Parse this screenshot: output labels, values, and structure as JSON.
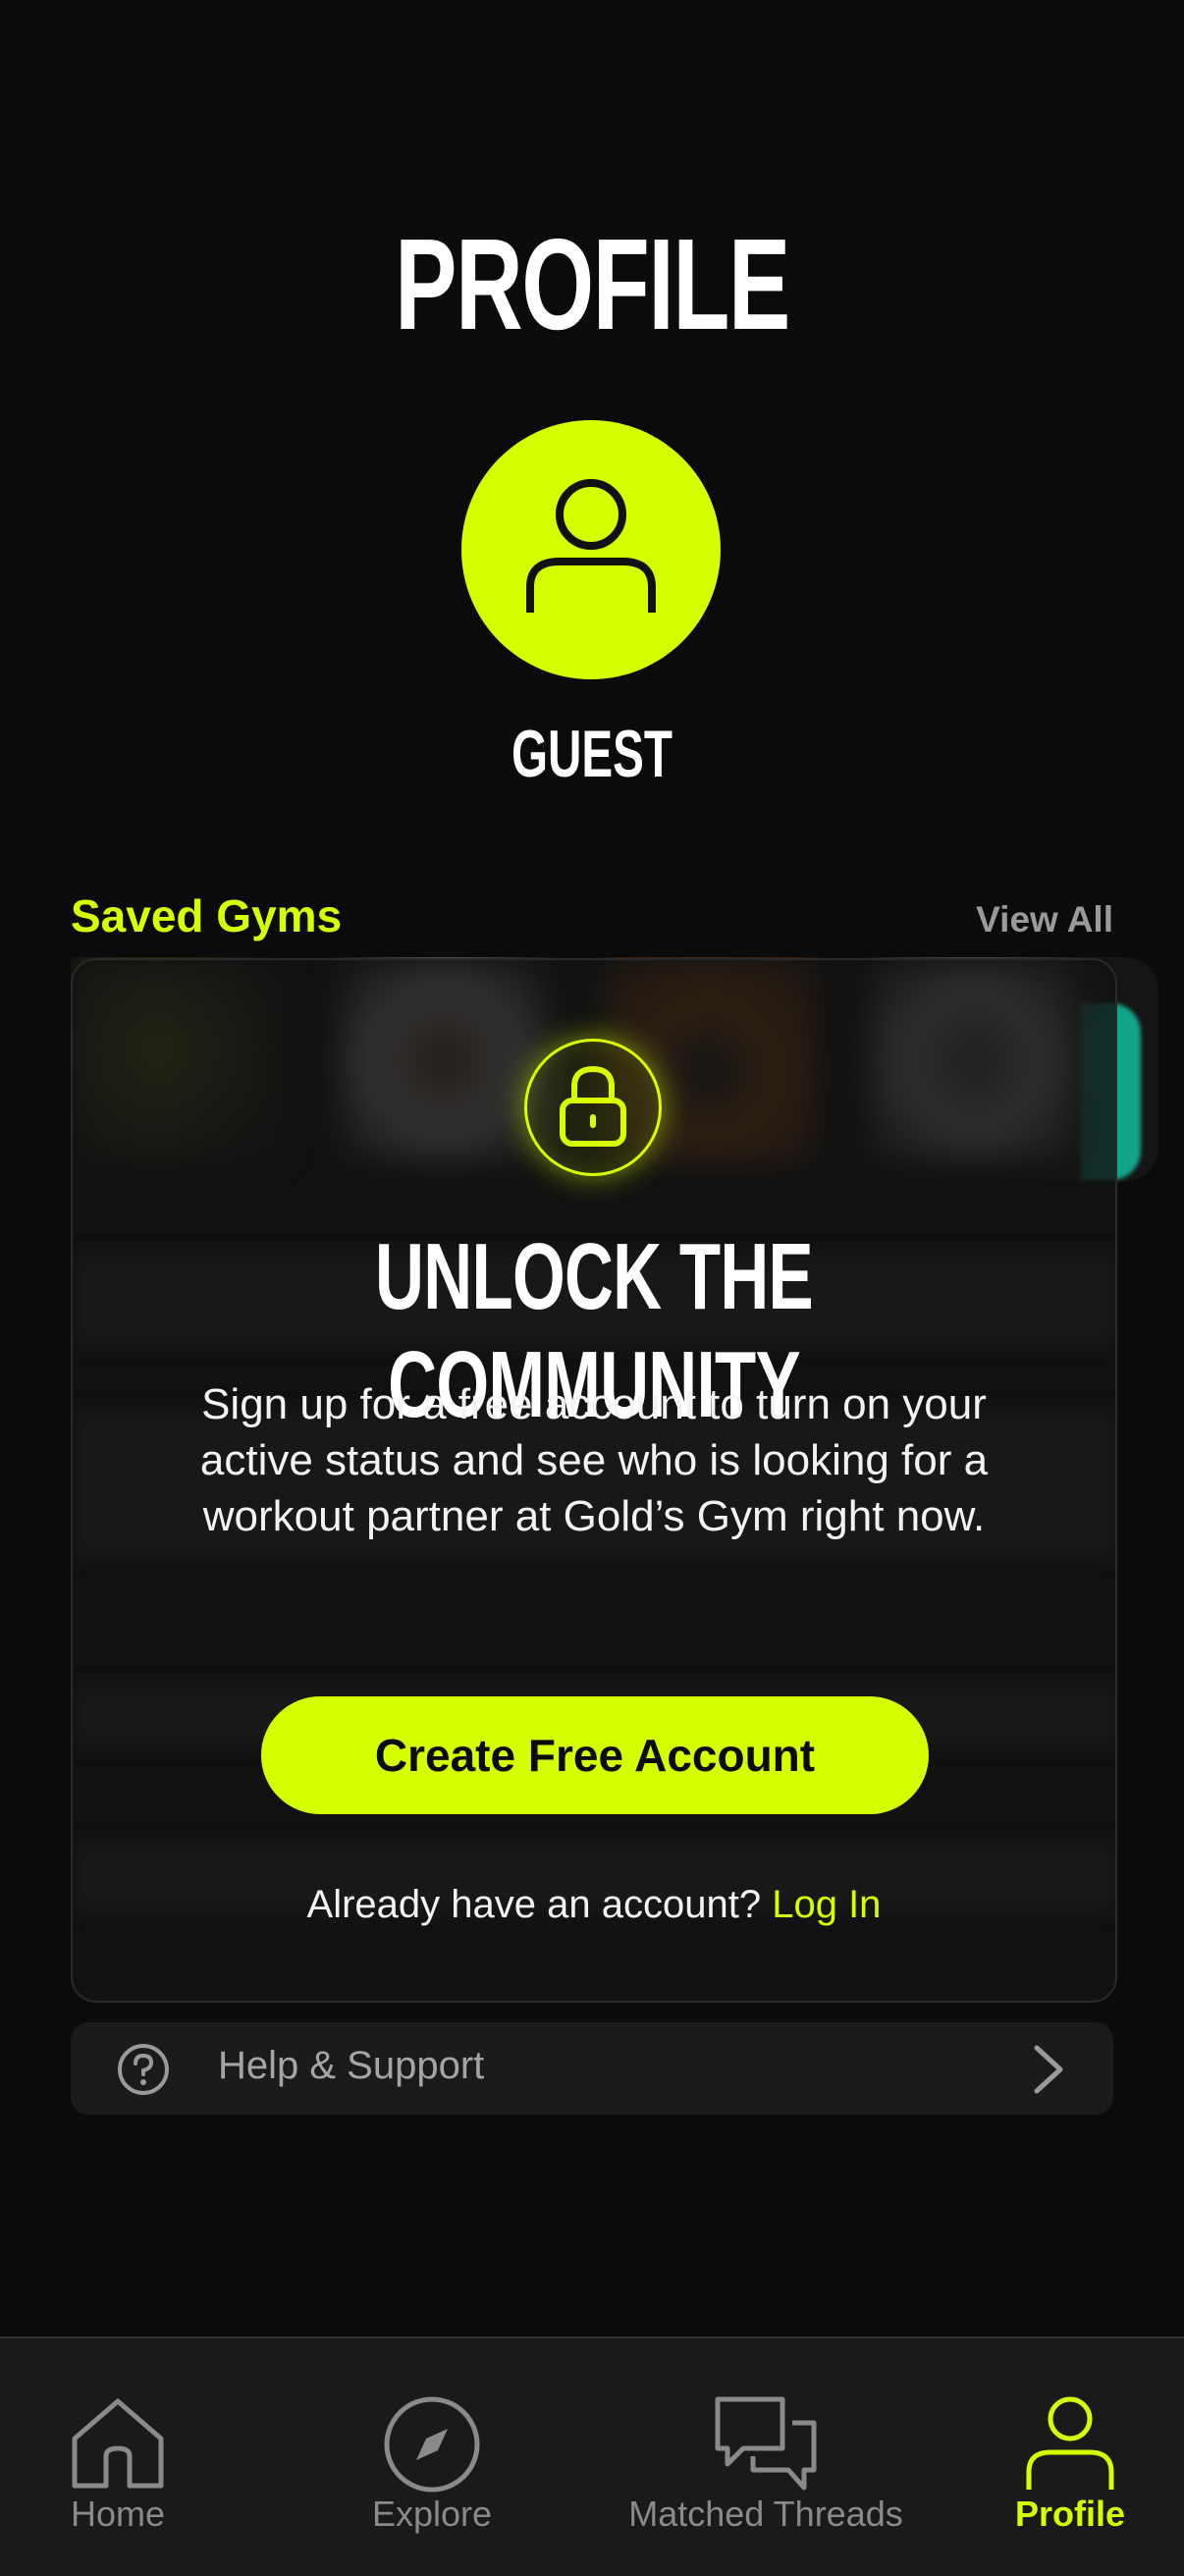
{
  "header": {
    "title": "PROFILE"
  },
  "profile": {
    "name": "GUEST"
  },
  "saved_gyms": {
    "title": "Saved Gyms",
    "view_all": "View All"
  },
  "locked_card": {
    "title": "UNLOCK THE COMMUNITY",
    "body": "Sign up for a free account to turn on your active status and see who is looking for a workout partner at Gold’s Gym right now.",
    "cta": "Create Free Account",
    "login_prompt": "Already have an account?",
    "login_link": "Log In"
  },
  "help": {
    "label": "Help & Support"
  },
  "tabs": [
    {
      "label": "Home",
      "icon": "home-icon"
    },
    {
      "label": "Explore",
      "icon": "compass-icon"
    },
    {
      "label": "Matched Threads",
      "icon": "chat-bubbles-icon"
    },
    {
      "label": "Profile",
      "icon": "person-icon"
    }
  ],
  "colors": {
    "accent": "#d8ff00",
    "background": "#0b0b0b",
    "teal": "#13a58a"
  }
}
